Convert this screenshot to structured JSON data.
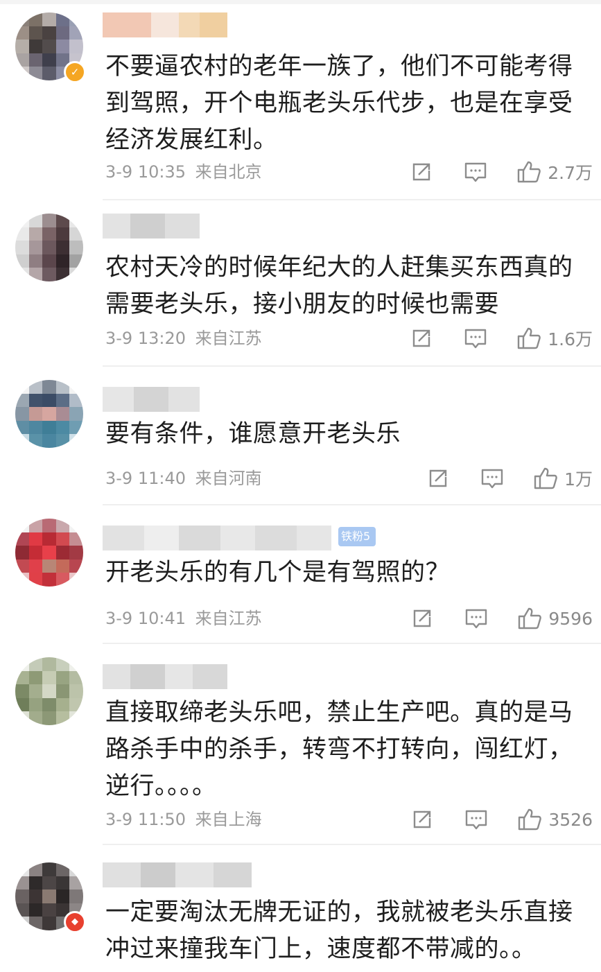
{
  "comments": [
    {
      "text": "不要逼农村的老年一族了，他们不可能考得到驾照，开个电瓶老头乐代步，也是在享受经济发展红利。",
      "time": "3-9 10:35",
      "location": "来自北京",
      "likes": "2.7万",
      "avatar_badge": "verified-badge-icon"
    },
    {
      "text": "农村天冷的时候年纪大的人赶集买东西真的需要老头乐，接小朋友的时候也需要",
      "time": "3-9 13:20",
      "location": "来自江苏",
      "likes": "1.6万"
    },
    {
      "text": "要有条件，谁愿意开老头乐",
      "time": "3-9 11:40",
      "location": "来自河南",
      "likes": "1万"
    },
    {
      "text": "开老头乐的有几个是有驾照的？",
      "time": "3-9 10:41",
      "location": "来自江苏",
      "likes": "9596",
      "fan_badge": "铁粉5"
    },
    {
      "text": "直接取缔老头乐吧，禁止生产吧。真的是马路杀手中的杀手，转弯不打转向，闯红灯，逆行。。。。",
      "time": "3-9 11:50",
      "location": "来自上海",
      "likes": "3526"
    },
    {
      "text": "一定要淘汰无牌无证的，我就被老头乐直接冲过来撞我车门上，速度都不带减的。。",
      "avatar_badge": "red-badge-icon"
    }
  ],
  "colors": {
    "icon_gray": "#8c8c8c",
    "verified": "#f5a623",
    "red_badge": "#e8402f",
    "fan_badge": "#a9c8f2"
  }
}
